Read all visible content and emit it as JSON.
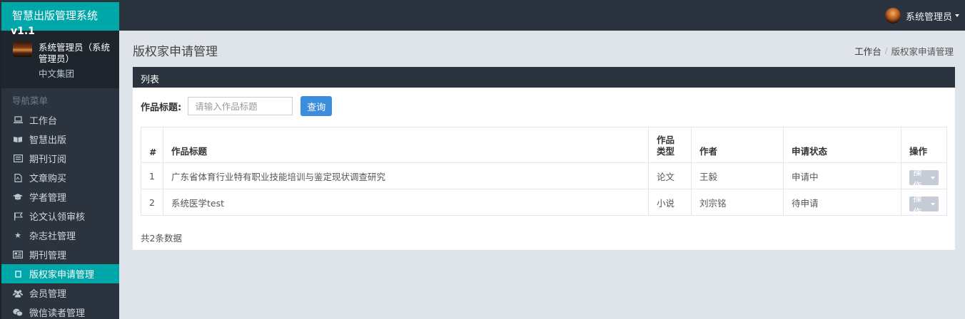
{
  "app": {
    "title": "智慧出版管理系统",
    "version": "v1.1"
  },
  "topbar": {
    "user_label": "系统管理员"
  },
  "user_panel": {
    "name": "系统管理员（系统管理员）",
    "org": "中文集团"
  },
  "sidebar": {
    "header": "导航菜单",
    "items": [
      {
        "label": "工作台",
        "icon": "laptop-icon"
      },
      {
        "label": "智慧出版",
        "icon": "book-open-icon"
      },
      {
        "label": "期刊订阅",
        "icon": "list-alt-icon"
      },
      {
        "label": "文章购买",
        "icon": "file-pdf-icon"
      },
      {
        "label": "学者管理",
        "icon": "graduation-cap-icon"
      },
      {
        "label": "论文认领审核",
        "icon": "flag-icon"
      },
      {
        "label": "杂志社管理",
        "icon": "star-icon"
      },
      {
        "label": "期刊管理",
        "icon": "newspaper-icon"
      },
      {
        "label": "版权家申请管理",
        "icon": "square-icon",
        "active": true
      },
      {
        "label": "会员管理",
        "icon": "users-icon"
      },
      {
        "label": "微信读者管理",
        "icon": "wechat-icon"
      }
    ]
  },
  "page": {
    "title": "版权家申请管理"
  },
  "breadcrumb": {
    "home": "工作台",
    "current": "版权家申请管理"
  },
  "panel": {
    "title": "列表"
  },
  "search": {
    "label": "作品标题:",
    "placeholder": "请输入作品标题",
    "button": "查询"
  },
  "table": {
    "headers": {
      "idx": "#",
      "title": "作品标题",
      "type_line1": "作品",
      "type_line2": "类型",
      "author": "作者",
      "status": "申请状态",
      "action": "操作"
    },
    "rows": [
      {
        "idx": "1",
        "title": "广东省体育行业特有职业技能培训与鉴定现状调查研究",
        "type": "论文",
        "author": "王毅",
        "status": "申请中",
        "action": "操作"
      },
      {
        "idx": "2",
        "title": "系统医学test",
        "type": "小说",
        "author": "刘宗铭",
        "status": "待申请",
        "action": "操作"
      }
    ]
  },
  "summary": {
    "total": "共2条数据"
  },
  "colors": {
    "topbar": "#2b333e",
    "accent": "#00a7a8",
    "button": "#3c8dde",
    "background": "#dfe4ea"
  }
}
